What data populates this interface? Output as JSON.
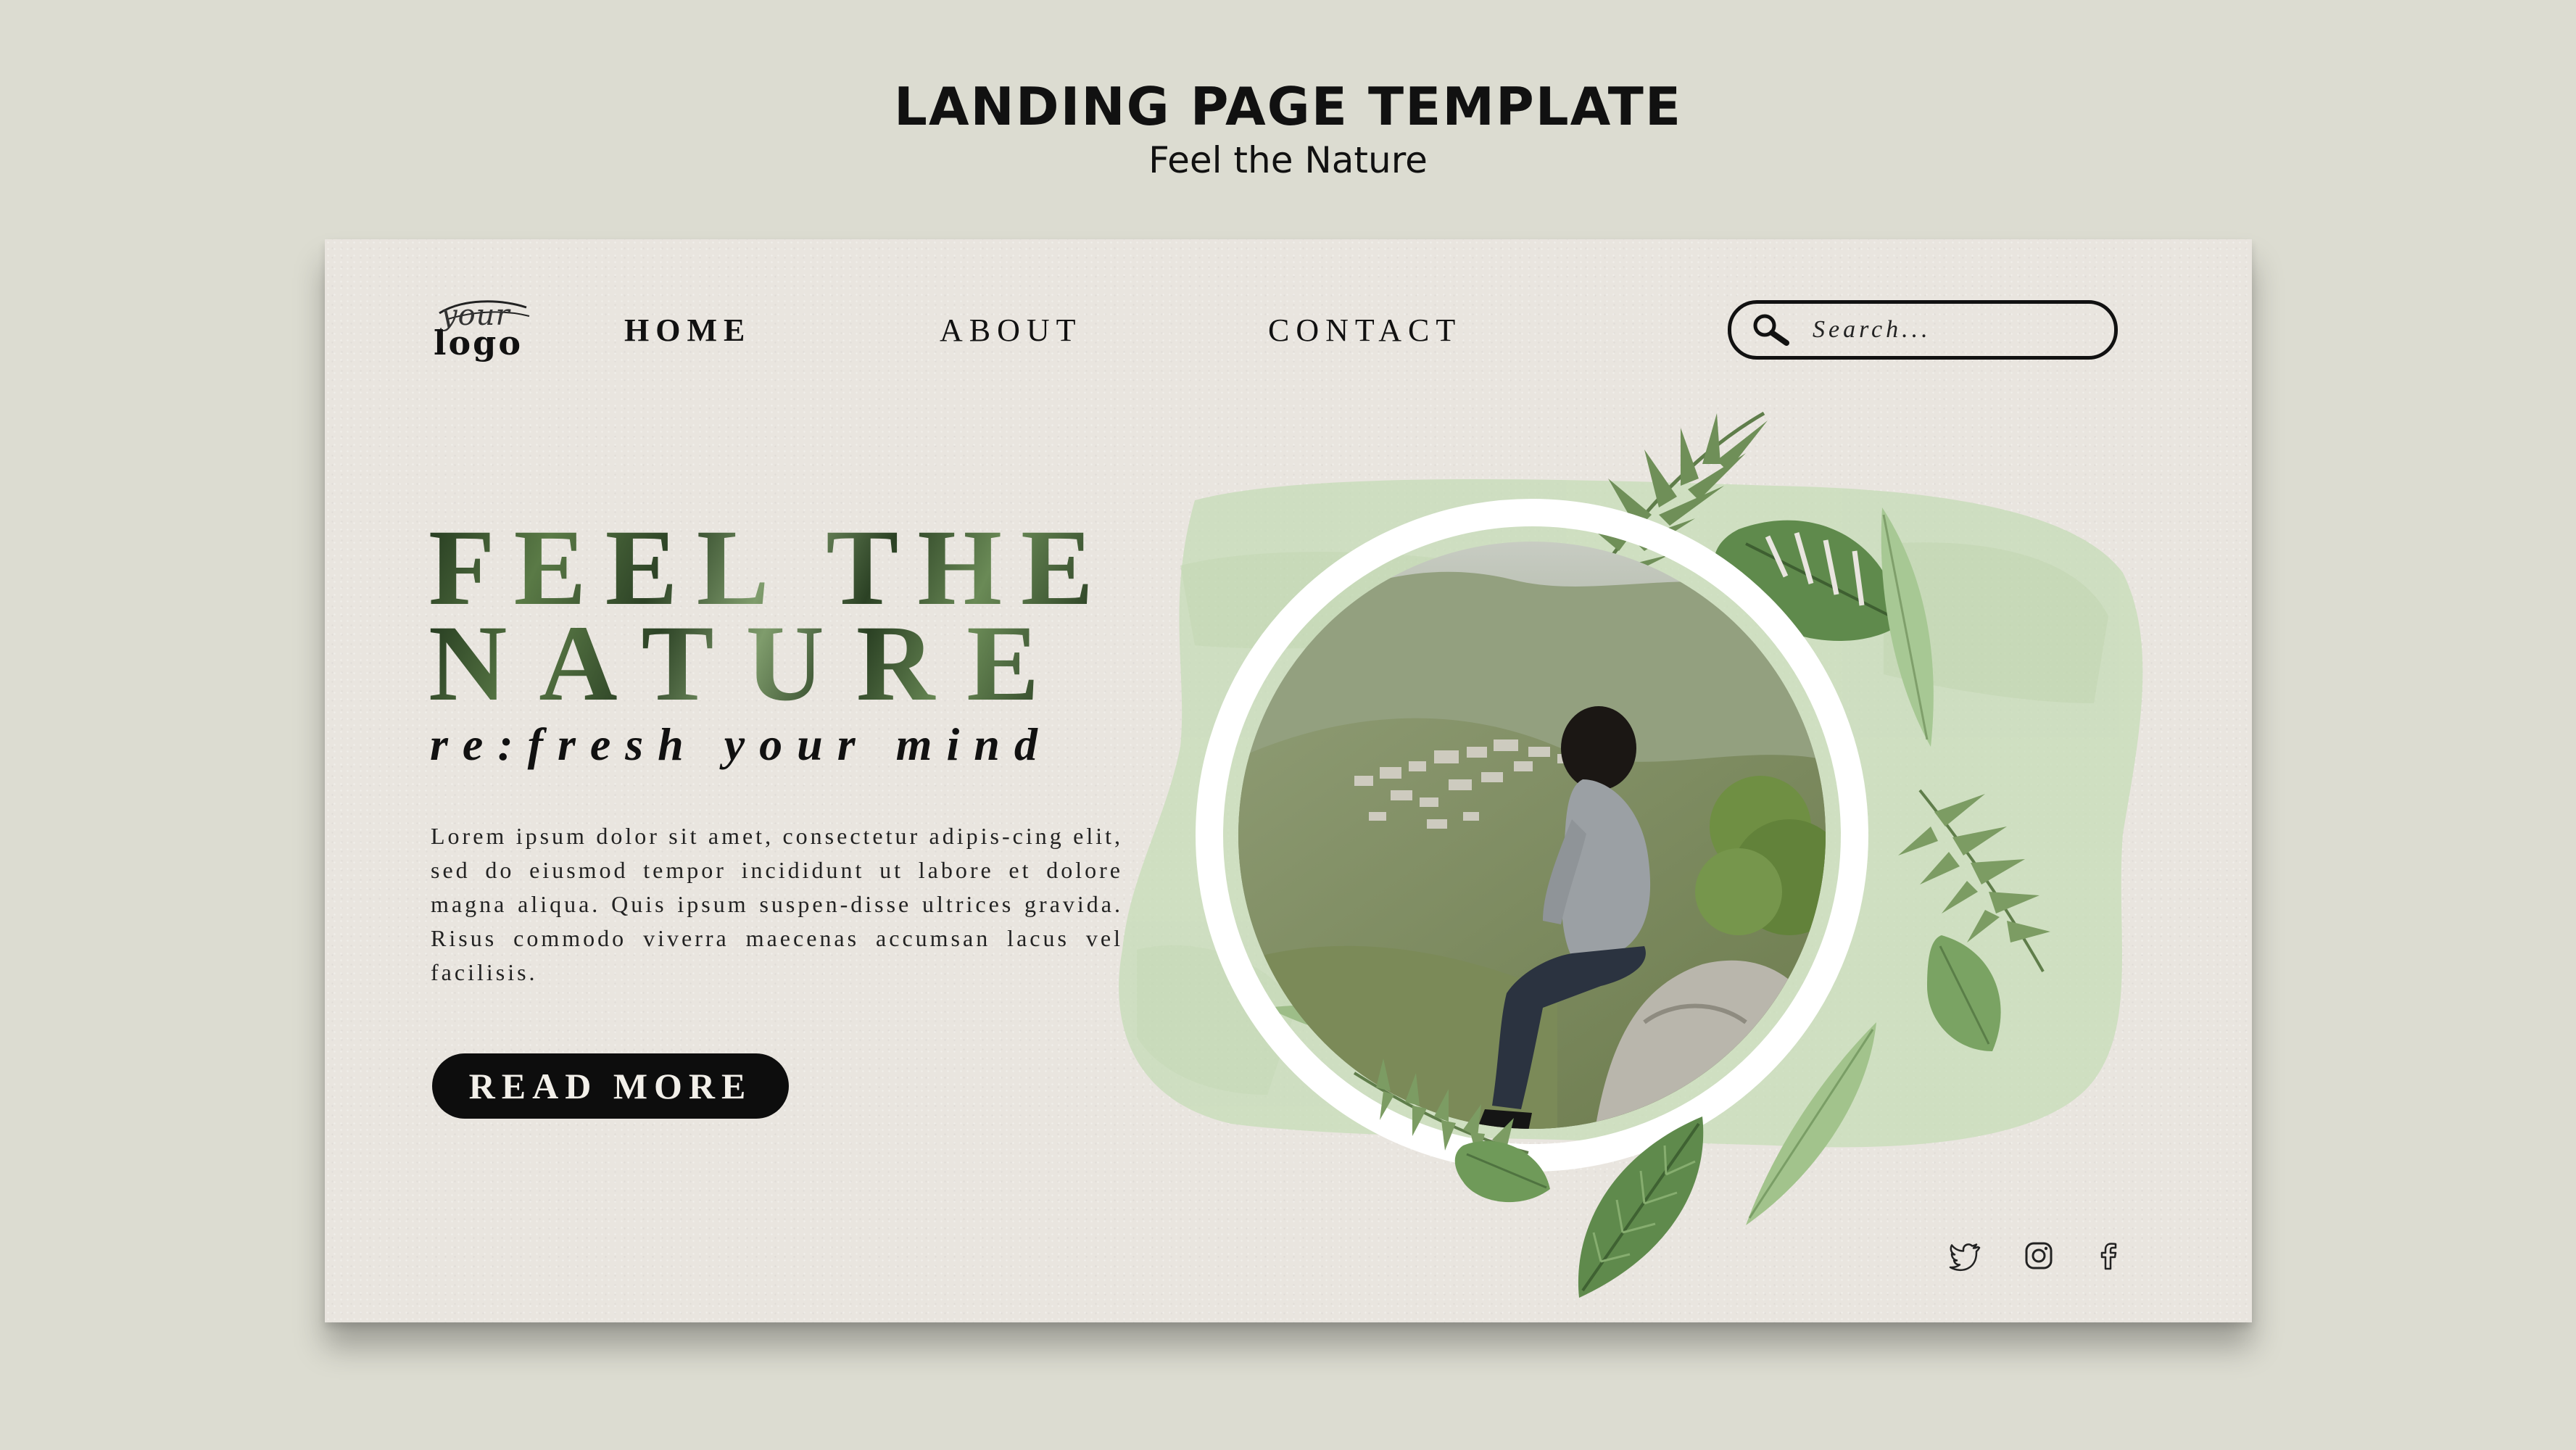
{
  "template": {
    "heading": "LANDING PAGE TEMPLATE",
    "subheading": "Feel the Nature"
  },
  "logo": {
    "line1": "your",
    "line2": "logo"
  },
  "nav": {
    "home": "HOME",
    "about": "ABOUT",
    "contact": "CONTACT"
  },
  "search": {
    "placeholder": "Search..."
  },
  "hero": {
    "line1": "FEEL THE",
    "line2": "NATURE",
    "tagline": "re:fresh your mind",
    "body": "Lorem ipsum dolor sit amet, consectetur adipis-cing elit, sed do eiusmod tempor incididunt ut labore et dolore magna aliqua. Quis ipsum suspen-disse ultrices gravida. Risus commodo viverra maecenas accumsan lacus vel facilisis.",
    "button": "READ MORE"
  },
  "social": [
    "twitter-icon",
    "instagram-icon",
    "facebook-icon"
  ],
  "colors": {
    "background": "#dcdcd1",
    "card": "#e9e5df",
    "accent_green": "#8fb57c",
    "wash_green": "#cfe0c4",
    "text": "#111111"
  }
}
